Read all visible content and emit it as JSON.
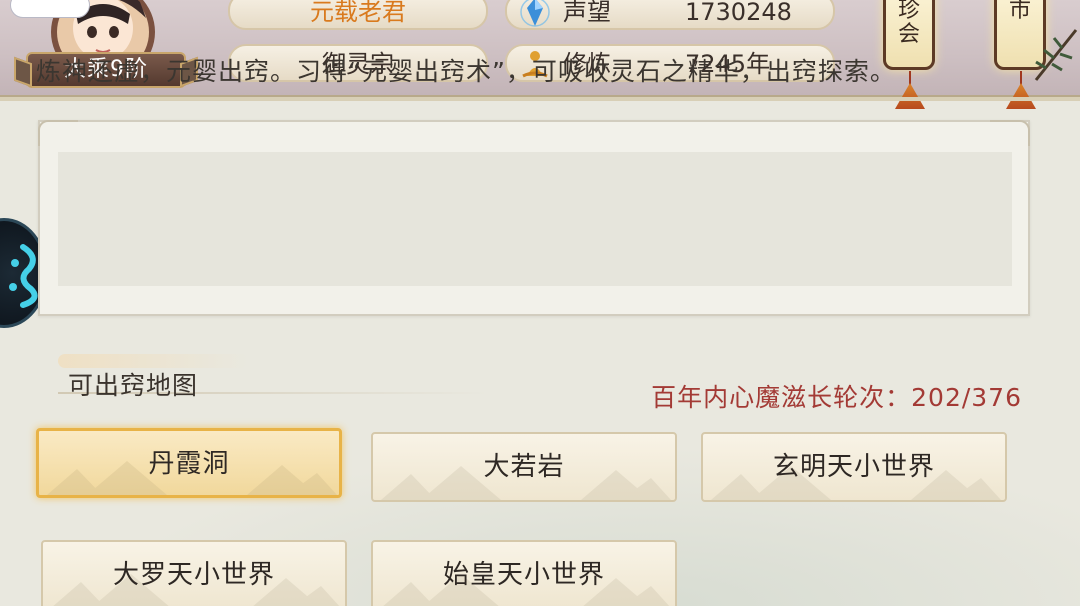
{
  "player": {
    "rank": "大乘9阶",
    "name": "元载老君",
    "sect": "御灵宗"
  },
  "stats": [
    {
      "icon": "prestige-crystal-icon",
      "label": "声望",
      "value": "1730248"
    },
    {
      "icon": "meditation-figure-icon",
      "label": "修炼",
      "value": "7245年"
    }
  ],
  "lanterns": [
    {
      "name": "treasure-fair",
      "text": "珍\n会"
    },
    {
      "name": "market",
      "text": "市"
    }
  ],
  "description": "炼神还虚，元婴出窍。习得“元婴出窍术”，可吸收灵石之精华，出窍探索。",
  "section": {
    "title": "可出窍地图",
    "round_label": "百年内心魔滋长轮次：202/376"
  },
  "maps": [
    {
      "label": "丹霞洞",
      "selected": true
    },
    {
      "label": "大若岩",
      "selected": false
    },
    {
      "label": "玄明天小世界",
      "selected": false
    },
    {
      "label": "大罗天小世界",
      "selected": false
    },
    {
      "label": "始皇天小世界",
      "selected": false
    }
  ],
  "colors": {
    "name_orange": "#d97a1e",
    "round_red": "#a33a35",
    "selected_gold": "#e8b347"
  }
}
